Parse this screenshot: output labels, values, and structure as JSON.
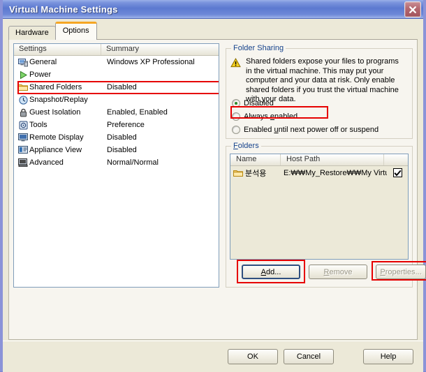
{
  "window": {
    "title": "Virtual Machine Settings",
    "close_icon": "close-icon"
  },
  "tabs": [
    {
      "label": "Hardware",
      "active": false
    },
    {
      "label": "Options",
      "active": true
    }
  ],
  "settings_list": {
    "columns": [
      "Settings",
      "Summary"
    ],
    "rows": [
      {
        "icon": "computer-icon",
        "name": "General",
        "summary": "Windows XP Professional"
      },
      {
        "icon": "power-play-icon",
        "name": "Power",
        "summary": ""
      },
      {
        "icon": "folder-icon",
        "name": "Shared Folders",
        "summary": "Disabled"
      },
      {
        "icon": "clock-icon",
        "name": "Snapshot/Replay",
        "summary": ""
      },
      {
        "icon": "lock-icon",
        "name": "Guest Isolation",
        "summary": "Enabled, Enabled"
      },
      {
        "icon": "tools-icon",
        "name": "Tools",
        "summary": "Preference"
      },
      {
        "icon": "remote-display-icon",
        "name": "Remote Display",
        "summary": "Disabled"
      },
      {
        "icon": "appliance-icon",
        "name": "Appliance View",
        "summary": "Disabled"
      },
      {
        "icon": "advanced-icon",
        "name": "Advanced",
        "summary": "Normal/Normal"
      }
    ]
  },
  "folder_sharing": {
    "legend": "Folder Sharing",
    "warning_icon": "warning-icon",
    "warning_text": "Shared folders expose your files to programs in the virtual machine. This may put your computer and your data at risk. Only enable shared folders if you trust the virtual machine with your data.",
    "options": [
      {
        "label_before": "",
        "accel": "D",
        "label_after": "isabled",
        "selected": true
      },
      {
        "label_before": "Always ",
        "accel": "e",
        "label_after": "nabled",
        "selected": false
      },
      {
        "label_before": "Enabled ",
        "accel": "u",
        "label_after": "ntil next power off or suspend",
        "selected": false
      }
    ]
  },
  "folders": {
    "legend_accel": "F",
    "legend_rest": "olders",
    "columns": [
      "Name",
      "Host Path",
      ""
    ],
    "rows": [
      {
        "icon": "folder-icon",
        "name": "분석용",
        "host_path": "E:₩₩My_Restore₩₩My Virtu...",
        "enabled": true,
        "check_glyph": "✔"
      }
    ],
    "buttons": [
      {
        "label_before": "",
        "accel": "A",
        "label_after": "dd...",
        "enabled": true,
        "default": true
      },
      {
        "label_before": "",
        "accel": "R",
        "label_after": "emove",
        "enabled": false,
        "default": false
      },
      {
        "label_before": "",
        "accel": "P",
        "label_after": "roperties...",
        "enabled": false,
        "default": false
      }
    ]
  },
  "dialog_buttons": [
    {
      "label": "OK"
    },
    {
      "label": "Cancel"
    },
    {
      "label": "Help"
    }
  ],
  "colors": {
    "title_bar": "#5c79d0",
    "highlight_box": "#e60000",
    "legend_text": "#15428b",
    "active_tab_accent": "#f5a623",
    "face": "#ece9d8"
  }
}
